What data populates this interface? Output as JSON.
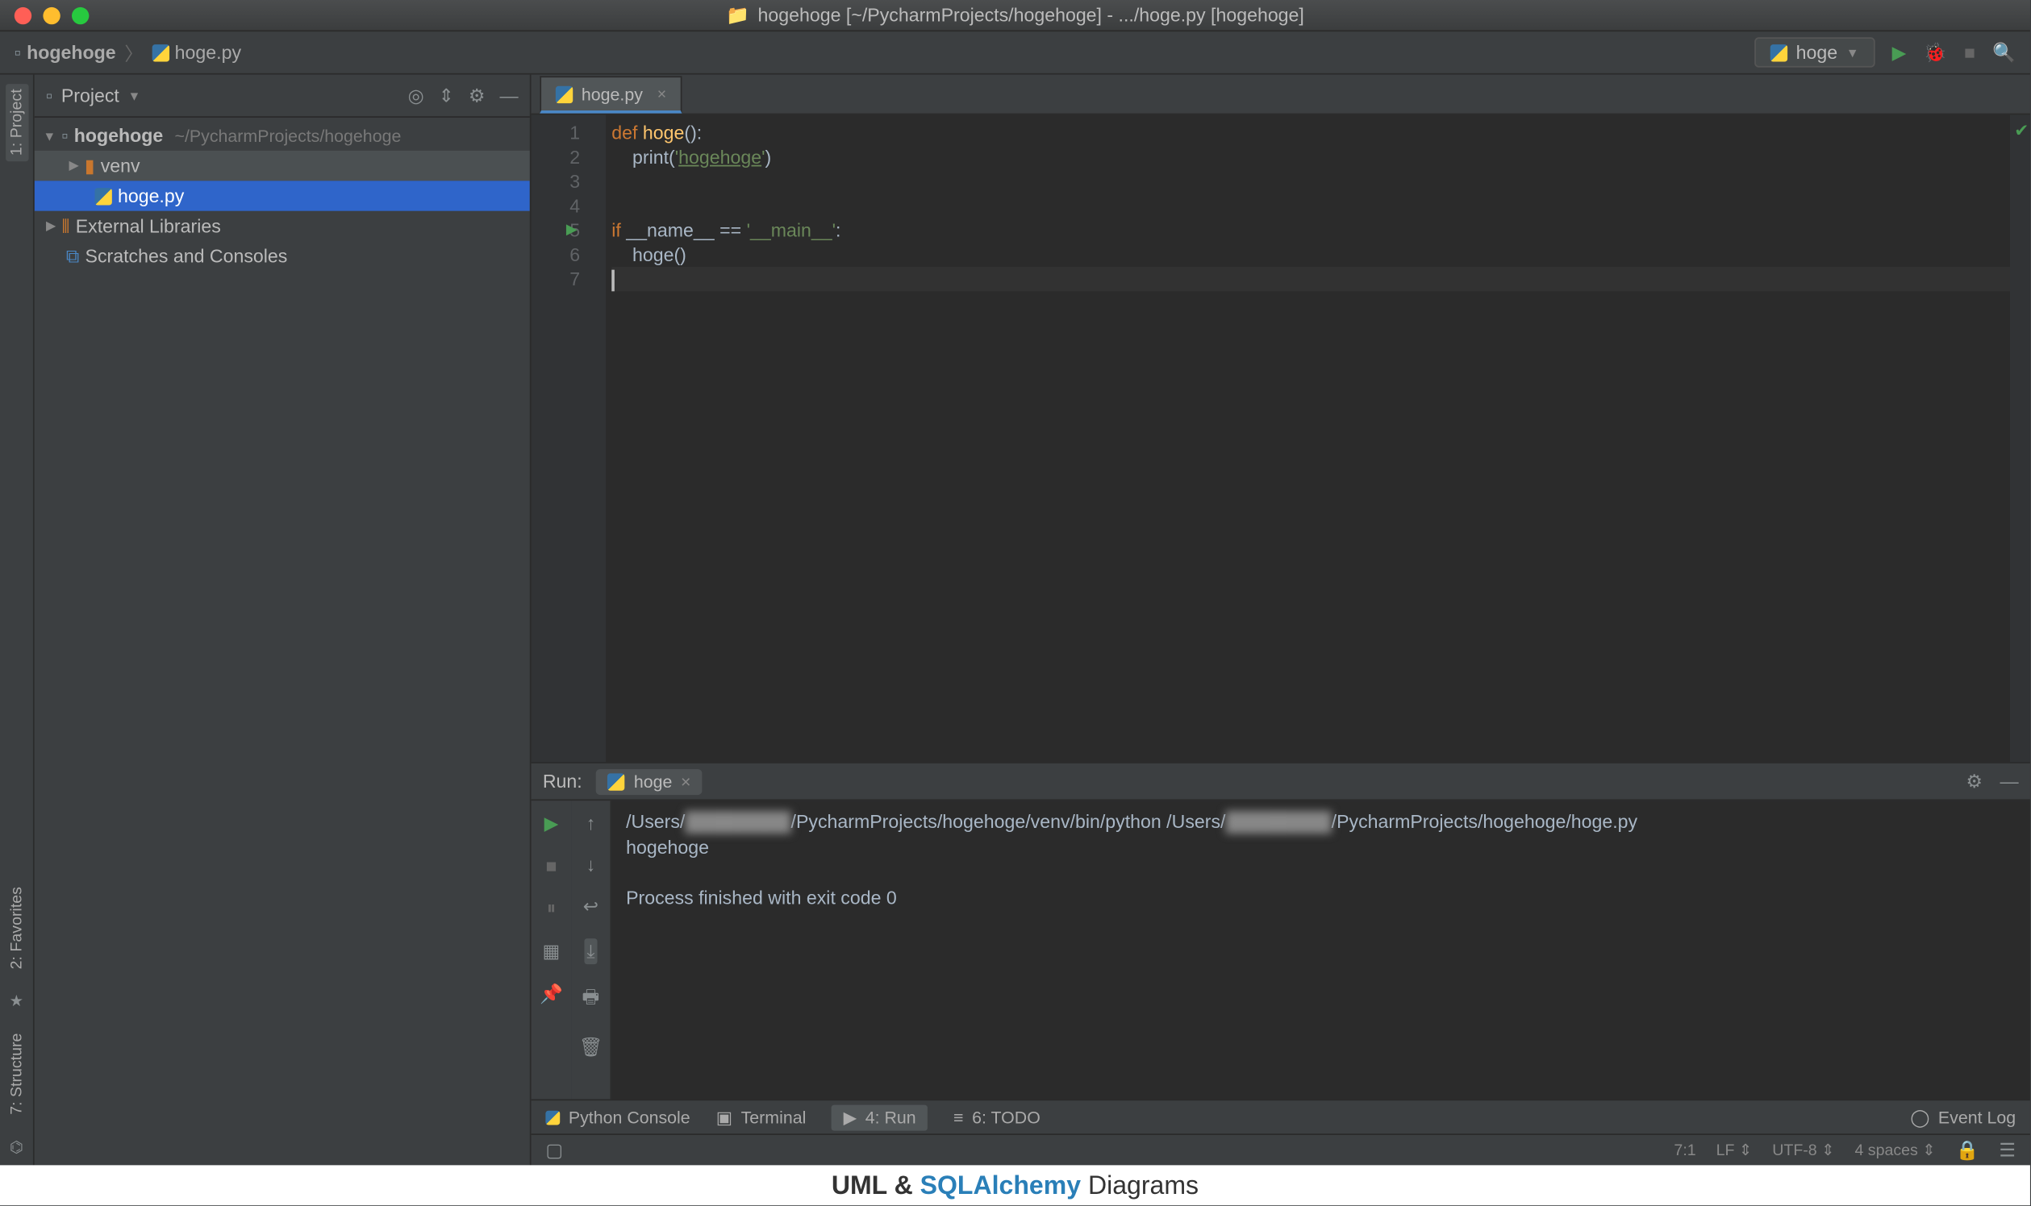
{
  "window": {
    "title": "hogehoge [~/PycharmProjects/hogehoge] - .../hoge.py [hogehoge]"
  },
  "breadcrumb": {
    "project": "hogehoge",
    "file": "hoge.py"
  },
  "run_config": {
    "name": "hoge"
  },
  "left_tabs": [
    "1: Project"
  ],
  "left_tabs_bottom": [
    "2: Favorites",
    "7: Structure"
  ],
  "sidebar": {
    "title": "Project",
    "tree": {
      "root": "hogehoge",
      "root_path": "~/PycharmProjects/hogehoge",
      "venv": "venv",
      "file": "hoge.py",
      "ext_lib": "External Libraries",
      "scratches": "Scratches and Consoles"
    }
  },
  "editor": {
    "tab": "hoge.py",
    "lines": [
      "1",
      "2",
      "3",
      "4",
      "5",
      "6",
      "7"
    ],
    "code": {
      "l1a": "def ",
      "l1b": "hoge",
      "l1c": "():",
      "l2a": "    print(",
      "l2b": "'",
      "l2c": "hogehoge",
      "l2d": "'",
      "l2e": ")",
      "l5a": "if ",
      "l5b": "__name__ == ",
      "l5c": "'__main__'",
      "l5d": ":",
      "l6": "    hoge()"
    }
  },
  "run": {
    "label": "Run:",
    "tab": "hoge",
    "out_line1_a": "/Users/",
    "out_line1_b": "/PycharmProjects/hogehoge/venv/bin/python /Users/",
    "out_line1_c": "/PycharmProjects/hogehoge/hoge.py",
    "out_line2": "hogehoge",
    "out_line4": "Process finished with exit code 0"
  },
  "bottom": {
    "python_console": "Python Console",
    "terminal": "Terminal",
    "run": "4: Run",
    "todo": "6: TODO",
    "event_log": "Event Log"
  },
  "status": {
    "pos": "7:1",
    "le": "LF",
    "enc": "UTF-8",
    "indent": "4 spaces"
  },
  "footer": {
    "uml": "UML & ",
    "sqa": "SQLAlchemy",
    "rest": " Diagrams"
  }
}
